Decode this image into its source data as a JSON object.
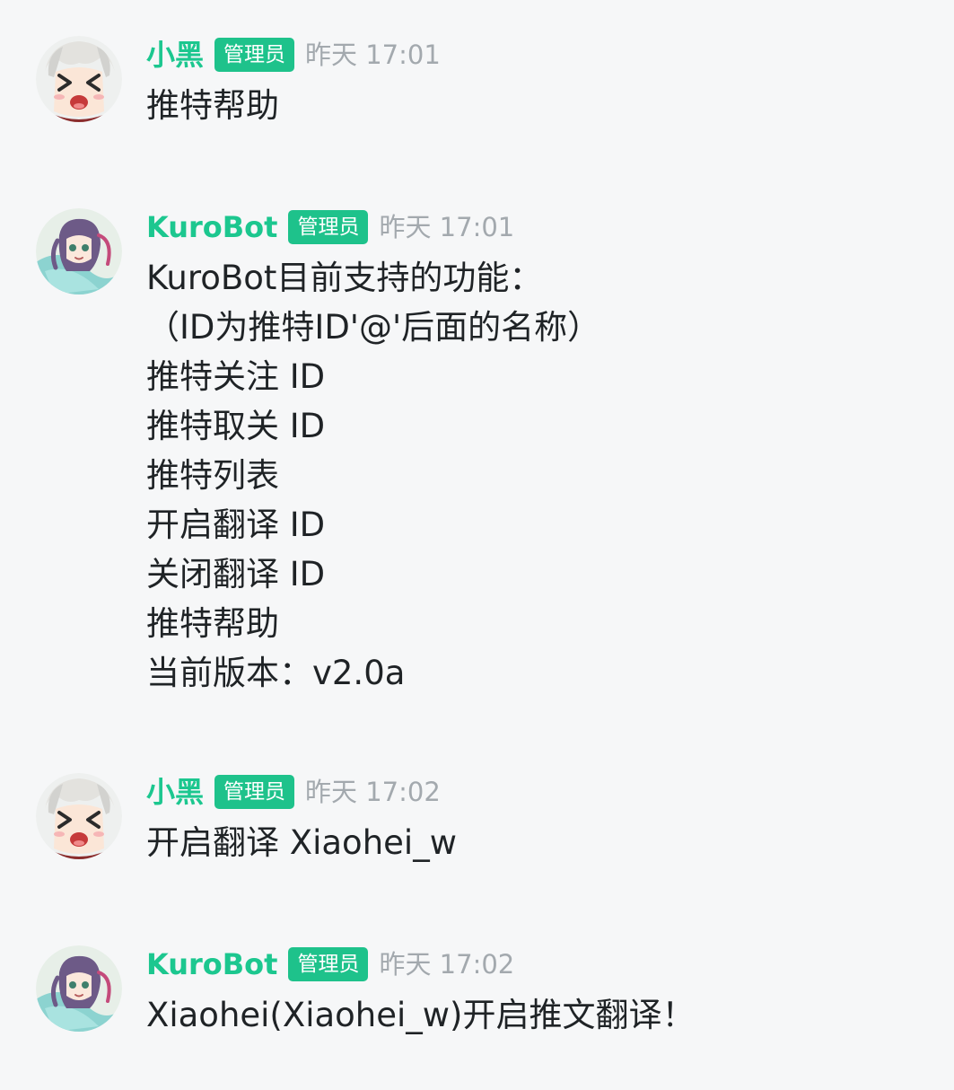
{
  "colors": {
    "background": "#f6f7f8",
    "username": "#1cc78f",
    "badge_bg": "#1ec28b",
    "badge_text": "#ffffff",
    "timestamp": "#a3a9ae",
    "message_text": "#1f2326"
  },
  "messages": [
    {
      "sender": "小黑",
      "role": "管理员",
      "time": "昨天 17:01",
      "avatar": "anime-avatar-xiaohei",
      "lines": [
        "推特帮助"
      ]
    },
    {
      "sender": "KuroBot",
      "role": "管理员",
      "time": "昨天 17:01",
      "avatar": "anime-avatar-kurobot",
      "lines": [
        "KuroBot目前支持的功能：",
        "（ID为推特ID'@'后面的名称）",
        "推特关注 ID",
        "推特取关 ID",
        "推特列表",
        "开启翻译 ID",
        "关闭翻译 ID",
        "推特帮助",
        "当前版本：v2.0a"
      ]
    },
    {
      "sender": "小黑",
      "role": "管理员",
      "time": "昨天 17:02",
      "avatar": "anime-avatar-xiaohei",
      "lines": [
        "开启翻译 Xiaohei_w"
      ]
    },
    {
      "sender": "KuroBot",
      "role": "管理员",
      "time": "昨天 17:02",
      "avatar": "anime-avatar-kurobot",
      "lines": [
        "Xiaohei(Xiaohei_w)开启推文翻译！"
      ]
    }
  ]
}
